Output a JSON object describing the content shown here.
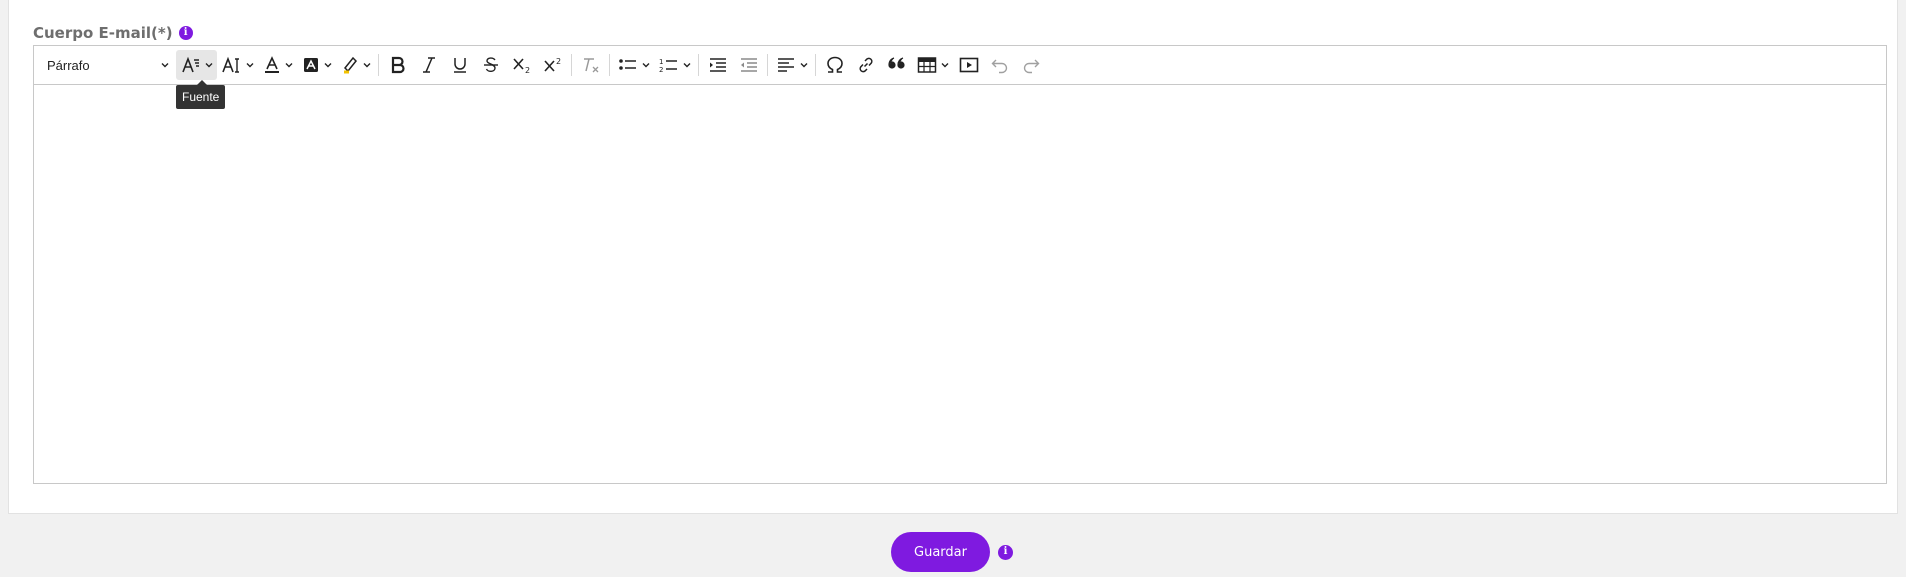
{
  "form": {
    "field_label": "Cuerpo E-mail(*)",
    "info_glyph": "i"
  },
  "editor": {
    "block_format": "Párrafo",
    "tooltip": "Fuente",
    "content": "",
    "toolbar_icons": [
      "font-family-icon",
      "font-size-icon",
      "font-color-icon",
      "font-background-icon",
      "highlight-icon",
      "bold-icon",
      "italic-icon",
      "underline-icon",
      "strikethrough-icon",
      "subscript-icon",
      "superscript-icon",
      "remove-format-icon",
      "bulleted-list-icon",
      "numbered-list-icon",
      "indent-icon",
      "outdent-icon",
      "alignment-icon",
      "special-characters-icon",
      "link-icon",
      "block-quote-icon",
      "insert-table-icon",
      "media-embed-icon",
      "undo-icon",
      "redo-icon"
    ]
  },
  "actions": {
    "save_label": "Guardar"
  },
  "colors": {
    "accent": "#7f1ae0",
    "tooltip_bg": "#333333",
    "page_bg": "#f1f1f1"
  }
}
